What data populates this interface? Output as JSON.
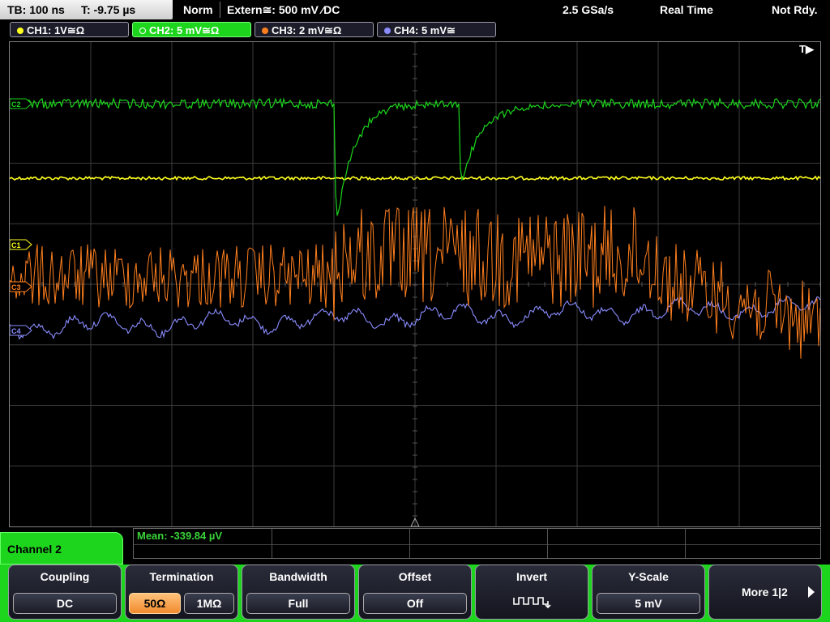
{
  "topbar": {
    "timebase": "TB: 100 ns",
    "trigger_time": "T: -9.75 µs",
    "mode": "Norm",
    "source": "Extern≅: 500 mV ⁄DC",
    "sample_rate": "2.5 GSa/s",
    "acq_mode": "Real Time",
    "status": "Not Rdy."
  },
  "channels": [
    {
      "label": "CH1: 1V≅Ω",
      "color": "#ffff1f",
      "active": false
    },
    {
      "label": "CH2: 5 mV≅Ω",
      "color": "#1cd51c",
      "active": true
    },
    {
      "label": "CH3: 2 mV≅Ω",
      "color": "#ff7f1e",
      "active": false
    },
    {
      "label": "CH4: 5 mV≅",
      "color": "#8a8cff",
      "active": false
    }
  ],
  "markers": {
    "c1": "C1",
    "c2": "C2",
    "c3": "C3",
    "c4": "C4",
    "trigger": "T▶"
  },
  "measurement": {
    "mean": "Mean: -339.84 µV"
  },
  "menu_title": "Channel 2",
  "softkeys": {
    "coupling": {
      "label": "Coupling",
      "value": "DC"
    },
    "termination": {
      "label": "Termination",
      "opt1": "50Ω",
      "opt2": "1MΩ"
    },
    "bandwidth": {
      "label": "Bandwidth",
      "value": "Full"
    },
    "offset": {
      "label": "Offset",
      "value": "Off"
    },
    "invert": {
      "label": "Invert",
      "icon": "invert-waveform-icon"
    },
    "yscale": {
      "label": "Y-Scale",
      "value": "5 mV"
    },
    "more": {
      "label": "More 1|2",
      "icon": "right-arrow-icon"
    }
  },
  "colors": {
    "ch1": "#ffff1f",
    "ch2": "#1cd51c",
    "ch3": "#ff7f1e",
    "ch4": "#8a8cff",
    "grid": "#3c3c3c"
  }
}
